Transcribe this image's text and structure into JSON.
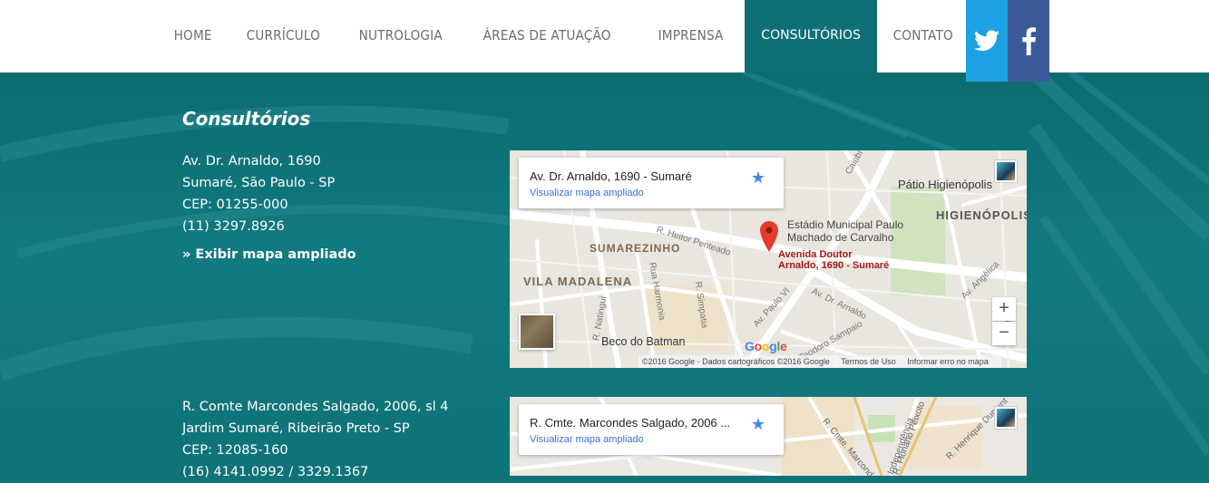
{
  "nav": {
    "items": [
      "HOME",
      "CURRÍCULO",
      "NUTROLOGIA",
      "ÁREAS DE ATUAÇÃO",
      "IMPRENSA",
      "CONSULTÓRIOS",
      "CONTATO"
    ],
    "active": "CONSULTÓRIOS",
    "social": [
      {
        "name": "twitter",
        "color": "#1da1e2"
      },
      {
        "name": "facebook",
        "color": "#3c5a99"
      }
    ]
  },
  "section": {
    "title": "Consultórios"
  },
  "offices": [
    {
      "lines": [
        "Av. Dr. Arnaldo, 1690",
        "Sumaré, São Paulo - SP",
        "CEP: 01255-000",
        "(11) 3297.8926"
      ],
      "link": "» Exibir mapa ampliado",
      "map": {
        "card_title": "Av. Dr. Arnaldo, 1690 - Sumaré",
        "card_link": "Visualizar mapa ampliado",
        "pin_label": [
          "Avenida Doutor",
          "Arnaldo, 1690 - Sumaré"
        ],
        "labels": {
          "patio": "Pátio Higienópolis",
          "higienopolis": "HIGIENÓPOLIS",
          "estadio1": "Estádio Municipal Paulo",
          "estadio2": "Machado de Carvalho",
          "sumarezinho": "SUMAREZINHO",
          "vila_madalena": "VILA MADALENA",
          "beco": "Beco do Batman",
          "heitor": "R. Heitor Penteado",
          "arnaldo": "Av. Dr. Arnaldo",
          "paulo_vi": "Av. Paulo VI",
          "harmonia": "Rua Harmonia",
          "simpatia": "R. Simpatia",
          "natingui": "R. Natingui",
          "caiubi": "Caiubi",
          "teodoro": "Teodoro Sampaio",
          "angelica": "Av. Angélica",
          "te": "Te"
        },
        "zoom_in": "+",
        "zoom_out": "−",
        "google": "Google",
        "footer": [
          "©2016 Google - Dados cartográficos ©2016 Google",
          "Termos de Uso",
          "Informar erro no mapa"
        ]
      }
    },
    {
      "lines": [
        "R. Comte Marcondes Salgado, 2006, sl 4",
        "Jardim Sumaré, Ribeirão Preto - SP",
        "CEP: 12085-160",
        "(16) 4141.0992 / 3329.1367"
      ],
      "map": {
        "card_title": "R. Cmte. Marcondes Salgado, 2006 ...",
        "card_link": "Visualizar mapa ampliado",
        "labels": {
          "floriano": "R. Floriano Peixoto",
          "independencia": "R. Independência",
          "henrique": "R. Henrique Dumont",
          "marcondes": "R. Cmte. Marcondes"
        }
      }
    }
  ]
}
